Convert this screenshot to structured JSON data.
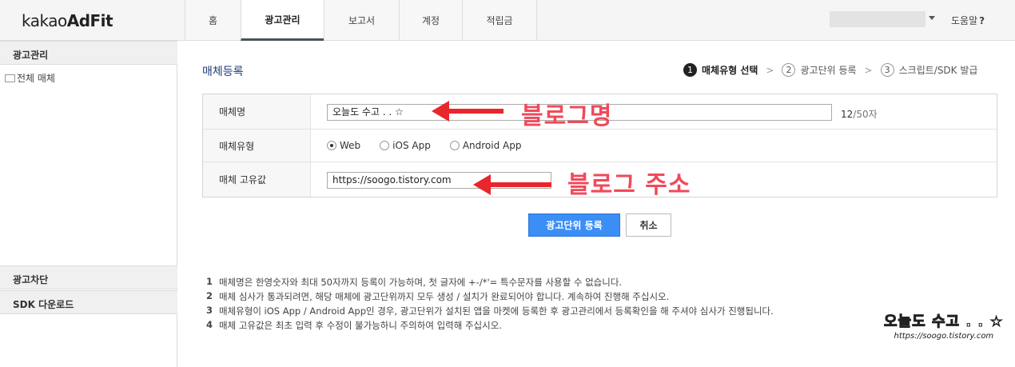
{
  "logo": {
    "light": "kakao",
    "bold": "AdFit"
  },
  "nav": {
    "items": [
      {
        "label": "홈",
        "name": "nav-home"
      },
      {
        "label": "광고관리",
        "name": "nav-ad-management"
      },
      {
        "label": "보고서",
        "name": "nav-reports"
      },
      {
        "label": "계정",
        "name": "nav-account"
      },
      {
        "label": "적립금",
        "name": "nav-reserve"
      }
    ],
    "active_index": 1
  },
  "help": {
    "label": "도움말",
    "icon": "?"
  },
  "sidebar": {
    "header": "광고관리",
    "tree_item": "전체 매체",
    "bottom_items": [
      "광고차단",
      "SDK 다운로드"
    ]
  },
  "page": {
    "title": "매체등록"
  },
  "steps": [
    {
      "num": "1",
      "label": "매체유형 선택",
      "active": true
    },
    {
      "num": "2",
      "label": "광고단위 등록",
      "active": false
    },
    {
      "num": "3",
      "label": "스크립트/SDK 발급",
      "active": false
    }
  ],
  "step_separator": ">",
  "form": {
    "name_label": "매체명",
    "name_value": "오늘도 수고 . . ☆",
    "counter_current": "12",
    "counter_rest": "/50자",
    "type_label": "매체유형",
    "type_options": [
      {
        "label": "Web",
        "selected": true
      },
      {
        "label": "iOS App",
        "selected": false
      },
      {
        "label": "Android App",
        "selected": false
      }
    ],
    "unique_label": "매체 고유값",
    "unique_value": "https://soogo.tistory.com"
  },
  "annotations": {
    "blog_name": "블로그명",
    "blog_address": "블로그 주소",
    "color": "#f04a5a"
  },
  "buttons": {
    "submit": "광고단위 등록",
    "cancel": "취소"
  },
  "notes": [
    {
      "num": "1",
      "text": "매체명은 한영숫자와 최대 50자까지 등록이 가능하며, 첫 글자에 +-/*'= 특수문자를 사용할 수 없습니다."
    },
    {
      "num": "2",
      "text": "매체 심사가 통과되려면, 해당 매체에 광고단위까지 모두 생성 / 설치가 완료되어야 합니다. 계속하여 진행해 주십시오."
    },
    {
      "num": "3",
      "text": "매체유형이 iOS App / Android App인 경우, 광고단위가 설치된 앱을 마켓에 등록한 후 광고관리에서 등록확인을 해 주셔야 심사가 진행됩니다."
    },
    {
      "num": "4",
      "text": "매체 고유값은 최초 입력 후 수정이 불가능하니 주의하여 입력해 주십시오."
    }
  ],
  "watermark": {
    "title": "오늘도 수고 . . ☆",
    "url": "https://soogo.tistory.com"
  },
  "colors": {
    "primary_button": "#3a8ef6",
    "title": "#1e3a78",
    "arrow": "#e8262c"
  }
}
